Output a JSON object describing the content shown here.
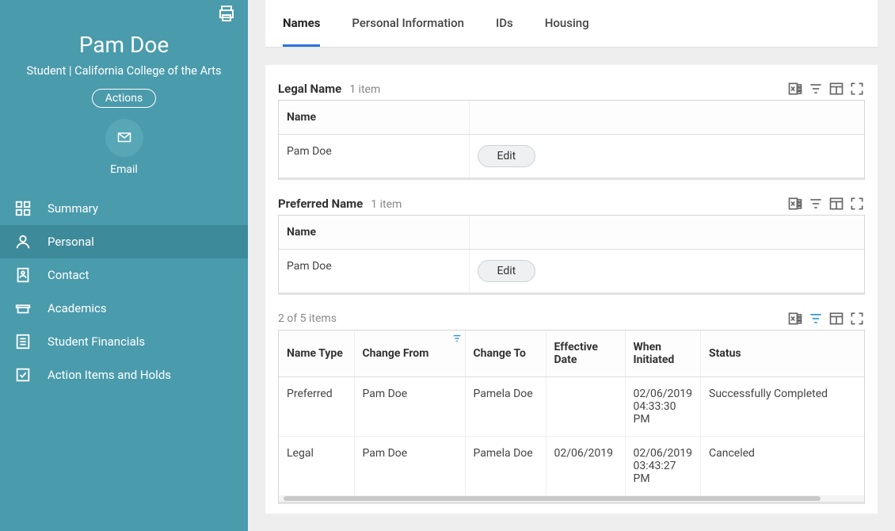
{
  "sidebar": {
    "student_name": "Pam Doe",
    "subtitle": "Student | California College of the Arts",
    "actions_label": "Actions",
    "email_label": "Email",
    "nav": [
      {
        "label": "Summary",
        "icon": "summary-icon"
      },
      {
        "label": "Personal",
        "icon": "person-icon",
        "active": true
      },
      {
        "label": "Contact",
        "icon": "contact-icon"
      },
      {
        "label": "Academics",
        "icon": "academics-icon"
      },
      {
        "label": "Student Financials",
        "icon": "financials-icon"
      },
      {
        "label": "Action Items and Holds",
        "icon": "checklist-icon"
      }
    ]
  },
  "tabs": [
    {
      "label": "Names",
      "active": true
    },
    {
      "label": "Personal Information"
    },
    {
      "label": "IDs"
    },
    {
      "label": "Housing"
    }
  ],
  "legal": {
    "title": "Legal Name",
    "count": "1 item",
    "headers": [
      "Name",
      ""
    ],
    "rows": [
      {
        "name": "Pam Doe",
        "action": "Edit"
      }
    ]
  },
  "preferred": {
    "title": "Preferred Name",
    "count": "1 item",
    "headers": [
      "Name",
      ""
    ],
    "rows": [
      {
        "name": "Pam Doe",
        "action": "Edit"
      }
    ]
  },
  "history": {
    "count": "2 of 5 items",
    "headers": [
      "Name Type",
      "Change From",
      "Change To",
      "Effective Date",
      "When Initiated",
      "Status"
    ],
    "rows": [
      {
        "name_type": "Preferred",
        "from": "Pam Doe",
        "to": "Pamela Doe",
        "effective": "",
        "initiated": "02/06/2019 04:33:30 PM",
        "status": "Successfully Completed"
      },
      {
        "name_type": "Legal",
        "from": "Pam Doe",
        "to": "Pamela Doe",
        "effective": "02/06/2019",
        "initiated": "02/06/2019 03:43:27 PM",
        "status": "Canceled"
      }
    ]
  }
}
